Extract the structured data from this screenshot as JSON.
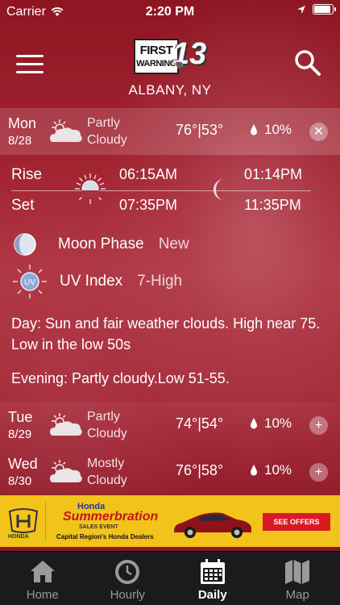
{
  "status_bar": {
    "carrier": "Carrier",
    "time": "2:20 PM",
    "battery_level": 0.95
  },
  "header": {
    "logo_text_1": "FIRST",
    "logo_text_2": "WARNING",
    "logo_number": "13",
    "location": "ALBANY, NY"
  },
  "days": [
    {
      "day": "Mon",
      "date": "8/28",
      "condition_1": "Partly",
      "condition_2": "Cloudy",
      "high": "76°",
      "low": "53°",
      "separator": "|",
      "precip": "10%",
      "toggle": "✕"
    },
    {
      "day": "Tue",
      "date": "8/29",
      "condition_1": "Partly",
      "condition_2": "Cloudy",
      "high": "74°",
      "low": "54°",
      "separator": "|",
      "precip": "10%",
      "toggle": "+"
    },
    {
      "day": "Wed",
      "date": "8/30",
      "condition_1": "Mostly",
      "condition_2": "Cloudy",
      "high": "76°",
      "low": "58°",
      "separator": "|",
      "precip": "10%",
      "toggle": "+"
    }
  ],
  "detail": {
    "rise_label": "Rise",
    "set_label": "Set",
    "sunrise": "06:15AM",
    "sunset": "07:35PM",
    "moonrise": "01:14PM",
    "moonset": "11:35PM",
    "moon_phase_label": "Moon Phase",
    "moon_phase_value": "New",
    "uv_label": "UV Index",
    "uv_value": "7-High",
    "uv_icon_text": "UV",
    "day_text": "Day: Sun and fair weather clouds. High near 75. Low in the low 50s",
    "evening_text": "Evening: Partly cloudy.Low 51-55."
  },
  "ad": {
    "brand": "HONDA",
    "title_1": "Honda",
    "title_2": "Summerbration",
    "subtitle": "SALES EVENT",
    "dealer": "Capital Region's Honda Dealers",
    "cta": "SEE OFFERS"
  },
  "tabs": [
    {
      "label": "Home",
      "icon": "home-icon"
    },
    {
      "label": "Hourly",
      "icon": "clock-icon"
    },
    {
      "label": "Daily",
      "icon": "calendar-icon"
    },
    {
      "label": "Map",
      "icon": "map-icon"
    }
  ],
  "colors": {
    "background": "#9a1f2c",
    "tab_bar": "#1b1b1d",
    "ad_background": "#f2c31a",
    "ad_cta": "#d81b22"
  }
}
